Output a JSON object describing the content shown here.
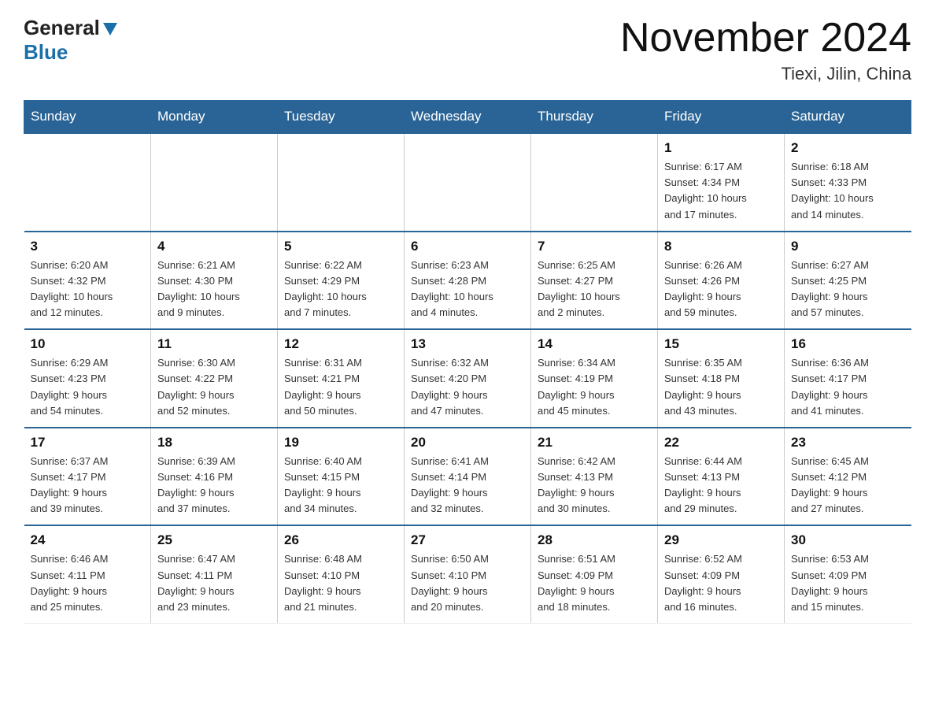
{
  "header": {
    "logo_general": "General",
    "logo_blue": "Blue",
    "month_title": "November 2024",
    "location": "Tiexi, Jilin, China"
  },
  "weekdays": [
    "Sunday",
    "Monday",
    "Tuesday",
    "Wednesday",
    "Thursday",
    "Friday",
    "Saturday"
  ],
  "weeks": [
    [
      {
        "day": "",
        "info": ""
      },
      {
        "day": "",
        "info": ""
      },
      {
        "day": "",
        "info": ""
      },
      {
        "day": "",
        "info": ""
      },
      {
        "day": "",
        "info": ""
      },
      {
        "day": "1",
        "info": "Sunrise: 6:17 AM\nSunset: 4:34 PM\nDaylight: 10 hours\nand 17 minutes."
      },
      {
        "day": "2",
        "info": "Sunrise: 6:18 AM\nSunset: 4:33 PM\nDaylight: 10 hours\nand 14 minutes."
      }
    ],
    [
      {
        "day": "3",
        "info": "Sunrise: 6:20 AM\nSunset: 4:32 PM\nDaylight: 10 hours\nand 12 minutes."
      },
      {
        "day": "4",
        "info": "Sunrise: 6:21 AM\nSunset: 4:30 PM\nDaylight: 10 hours\nand 9 minutes."
      },
      {
        "day": "5",
        "info": "Sunrise: 6:22 AM\nSunset: 4:29 PM\nDaylight: 10 hours\nand 7 minutes."
      },
      {
        "day": "6",
        "info": "Sunrise: 6:23 AM\nSunset: 4:28 PM\nDaylight: 10 hours\nand 4 minutes."
      },
      {
        "day": "7",
        "info": "Sunrise: 6:25 AM\nSunset: 4:27 PM\nDaylight: 10 hours\nand 2 minutes."
      },
      {
        "day": "8",
        "info": "Sunrise: 6:26 AM\nSunset: 4:26 PM\nDaylight: 9 hours\nand 59 minutes."
      },
      {
        "day": "9",
        "info": "Sunrise: 6:27 AM\nSunset: 4:25 PM\nDaylight: 9 hours\nand 57 minutes."
      }
    ],
    [
      {
        "day": "10",
        "info": "Sunrise: 6:29 AM\nSunset: 4:23 PM\nDaylight: 9 hours\nand 54 minutes."
      },
      {
        "day": "11",
        "info": "Sunrise: 6:30 AM\nSunset: 4:22 PM\nDaylight: 9 hours\nand 52 minutes."
      },
      {
        "day": "12",
        "info": "Sunrise: 6:31 AM\nSunset: 4:21 PM\nDaylight: 9 hours\nand 50 minutes."
      },
      {
        "day": "13",
        "info": "Sunrise: 6:32 AM\nSunset: 4:20 PM\nDaylight: 9 hours\nand 47 minutes."
      },
      {
        "day": "14",
        "info": "Sunrise: 6:34 AM\nSunset: 4:19 PM\nDaylight: 9 hours\nand 45 minutes."
      },
      {
        "day": "15",
        "info": "Sunrise: 6:35 AM\nSunset: 4:18 PM\nDaylight: 9 hours\nand 43 minutes."
      },
      {
        "day": "16",
        "info": "Sunrise: 6:36 AM\nSunset: 4:17 PM\nDaylight: 9 hours\nand 41 minutes."
      }
    ],
    [
      {
        "day": "17",
        "info": "Sunrise: 6:37 AM\nSunset: 4:17 PM\nDaylight: 9 hours\nand 39 minutes."
      },
      {
        "day": "18",
        "info": "Sunrise: 6:39 AM\nSunset: 4:16 PM\nDaylight: 9 hours\nand 37 minutes."
      },
      {
        "day": "19",
        "info": "Sunrise: 6:40 AM\nSunset: 4:15 PM\nDaylight: 9 hours\nand 34 minutes."
      },
      {
        "day": "20",
        "info": "Sunrise: 6:41 AM\nSunset: 4:14 PM\nDaylight: 9 hours\nand 32 minutes."
      },
      {
        "day": "21",
        "info": "Sunrise: 6:42 AM\nSunset: 4:13 PM\nDaylight: 9 hours\nand 30 minutes."
      },
      {
        "day": "22",
        "info": "Sunrise: 6:44 AM\nSunset: 4:13 PM\nDaylight: 9 hours\nand 29 minutes."
      },
      {
        "day": "23",
        "info": "Sunrise: 6:45 AM\nSunset: 4:12 PM\nDaylight: 9 hours\nand 27 minutes."
      }
    ],
    [
      {
        "day": "24",
        "info": "Sunrise: 6:46 AM\nSunset: 4:11 PM\nDaylight: 9 hours\nand 25 minutes."
      },
      {
        "day": "25",
        "info": "Sunrise: 6:47 AM\nSunset: 4:11 PM\nDaylight: 9 hours\nand 23 minutes."
      },
      {
        "day": "26",
        "info": "Sunrise: 6:48 AM\nSunset: 4:10 PM\nDaylight: 9 hours\nand 21 minutes."
      },
      {
        "day": "27",
        "info": "Sunrise: 6:50 AM\nSunset: 4:10 PM\nDaylight: 9 hours\nand 20 minutes."
      },
      {
        "day": "28",
        "info": "Sunrise: 6:51 AM\nSunset: 4:09 PM\nDaylight: 9 hours\nand 18 minutes."
      },
      {
        "day": "29",
        "info": "Sunrise: 6:52 AM\nSunset: 4:09 PM\nDaylight: 9 hours\nand 16 minutes."
      },
      {
        "day": "30",
        "info": "Sunrise: 6:53 AM\nSunset: 4:09 PM\nDaylight: 9 hours\nand 15 minutes."
      }
    ]
  ]
}
